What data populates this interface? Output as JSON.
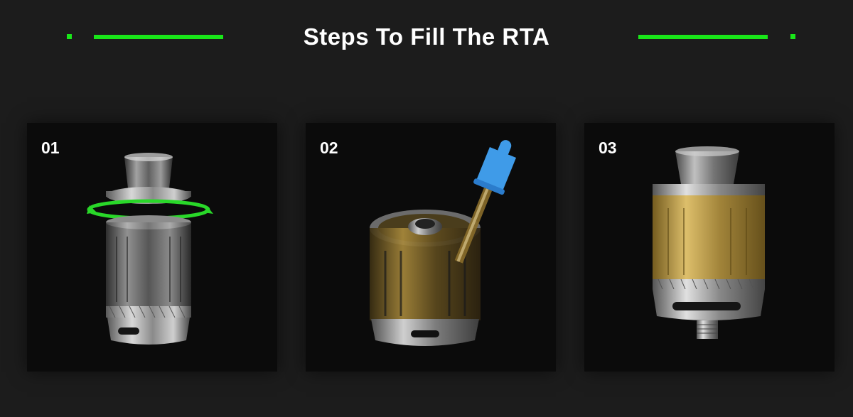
{
  "header": {
    "title": "Steps To Fill The RTA",
    "accent_color": "#19e619"
  },
  "steps": [
    {
      "number": "01",
      "illustration": "tank-unscrew-top-cap"
    },
    {
      "number": "02",
      "illustration": "dropper-fill-tank"
    },
    {
      "number": "03",
      "illustration": "filled-tank-assembled"
    }
  ]
}
